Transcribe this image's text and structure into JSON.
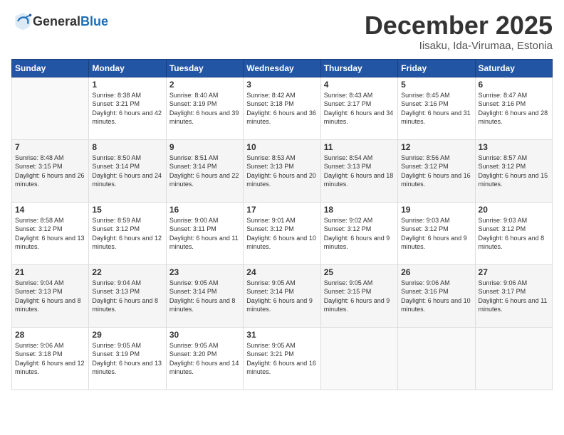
{
  "header": {
    "logo_general": "General",
    "logo_blue": "Blue",
    "month_title": "December 2025",
    "location": "Iisaku, Ida-Virumaa, Estonia"
  },
  "weekdays": [
    "Sunday",
    "Monday",
    "Tuesday",
    "Wednesday",
    "Thursday",
    "Friday",
    "Saturday"
  ],
  "weeks": [
    [
      {
        "num": "",
        "sunrise": "",
        "sunset": "",
        "daylight": "",
        "empty": true
      },
      {
        "num": "1",
        "sunrise": "Sunrise: 8:38 AM",
        "sunset": "Sunset: 3:21 PM",
        "daylight": "Daylight: 6 hours and 42 minutes."
      },
      {
        "num": "2",
        "sunrise": "Sunrise: 8:40 AM",
        "sunset": "Sunset: 3:19 PM",
        "daylight": "Daylight: 6 hours and 39 minutes."
      },
      {
        "num": "3",
        "sunrise": "Sunrise: 8:42 AM",
        "sunset": "Sunset: 3:18 PM",
        "daylight": "Daylight: 6 hours and 36 minutes."
      },
      {
        "num": "4",
        "sunrise": "Sunrise: 8:43 AM",
        "sunset": "Sunset: 3:17 PM",
        "daylight": "Daylight: 6 hours and 34 minutes."
      },
      {
        "num": "5",
        "sunrise": "Sunrise: 8:45 AM",
        "sunset": "Sunset: 3:16 PM",
        "daylight": "Daylight: 6 hours and 31 minutes."
      },
      {
        "num": "6",
        "sunrise": "Sunrise: 8:47 AM",
        "sunset": "Sunset: 3:16 PM",
        "daylight": "Daylight: 6 hours and 28 minutes."
      }
    ],
    [
      {
        "num": "7",
        "sunrise": "Sunrise: 8:48 AM",
        "sunset": "Sunset: 3:15 PM",
        "daylight": "Daylight: 6 hours and 26 minutes."
      },
      {
        "num": "8",
        "sunrise": "Sunrise: 8:50 AM",
        "sunset": "Sunset: 3:14 PM",
        "daylight": "Daylight: 6 hours and 24 minutes."
      },
      {
        "num": "9",
        "sunrise": "Sunrise: 8:51 AM",
        "sunset": "Sunset: 3:14 PM",
        "daylight": "Daylight: 6 hours and 22 minutes."
      },
      {
        "num": "10",
        "sunrise": "Sunrise: 8:53 AM",
        "sunset": "Sunset: 3:13 PM",
        "daylight": "Daylight: 6 hours and 20 minutes."
      },
      {
        "num": "11",
        "sunrise": "Sunrise: 8:54 AM",
        "sunset": "Sunset: 3:13 PM",
        "daylight": "Daylight: 6 hours and 18 minutes."
      },
      {
        "num": "12",
        "sunrise": "Sunrise: 8:56 AM",
        "sunset": "Sunset: 3:12 PM",
        "daylight": "Daylight: 6 hours and 16 minutes."
      },
      {
        "num": "13",
        "sunrise": "Sunrise: 8:57 AM",
        "sunset": "Sunset: 3:12 PM",
        "daylight": "Daylight: 6 hours and 15 minutes."
      }
    ],
    [
      {
        "num": "14",
        "sunrise": "Sunrise: 8:58 AM",
        "sunset": "Sunset: 3:12 PM",
        "daylight": "Daylight: 6 hours and 13 minutes."
      },
      {
        "num": "15",
        "sunrise": "Sunrise: 8:59 AM",
        "sunset": "Sunset: 3:12 PM",
        "daylight": "Daylight: 6 hours and 12 minutes."
      },
      {
        "num": "16",
        "sunrise": "Sunrise: 9:00 AM",
        "sunset": "Sunset: 3:11 PM",
        "daylight": "Daylight: 6 hours and 11 minutes."
      },
      {
        "num": "17",
        "sunrise": "Sunrise: 9:01 AM",
        "sunset": "Sunset: 3:12 PM",
        "daylight": "Daylight: 6 hours and 10 minutes."
      },
      {
        "num": "18",
        "sunrise": "Sunrise: 9:02 AM",
        "sunset": "Sunset: 3:12 PM",
        "daylight": "Daylight: 6 hours and 9 minutes."
      },
      {
        "num": "19",
        "sunrise": "Sunrise: 9:03 AM",
        "sunset": "Sunset: 3:12 PM",
        "daylight": "Daylight: 6 hours and 9 minutes."
      },
      {
        "num": "20",
        "sunrise": "Sunrise: 9:03 AM",
        "sunset": "Sunset: 3:12 PM",
        "daylight": "Daylight: 6 hours and 8 minutes."
      }
    ],
    [
      {
        "num": "21",
        "sunrise": "Sunrise: 9:04 AM",
        "sunset": "Sunset: 3:13 PM",
        "daylight": "Daylight: 6 hours and 8 minutes."
      },
      {
        "num": "22",
        "sunrise": "Sunrise: 9:04 AM",
        "sunset": "Sunset: 3:13 PM",
        "daylight": "Daylight: 6 hours and 8 minutes."
      },
      {
        "num": "23",
        "sunrise": "Sunrise: 9:05 AM",
        "sunset": "Sunset: 3:14 PM",
        "daylight": "Daylight: 6 hours and 8 minutes."
      },
      {
        "num": "24",
        "sunrise": "Sunrise: 9:05 AM",
        "sunset": "Sunset: 3:14 PM",
        "daylight": "Daylight: 6 hours and 9 minutes."
      },
      {
        "num": "25",
        "sunrise": "Sunrise: 9:05 AM",
        "sunset": "Sunset: 3:15 PM",
        "daylight": "Daylight: 6 hours and 9 minutes."
      },
      {
        "num": "26",
        "sunrise": "Sunrise: 9:06 AM",
        "sunset": "Sunset: 3:16 PM",
        "daylight": "Daylight: 6 hours and 10 minutes."
      },
      {
        "num": "27",
        "sunrise": "Sunrise: 9:06 AM",
        "sunset": "Sunset: 3:17 PM",
        "daylight": "Daylight: 6 hours and 11 minutes."
      }
    ],
    [
      {
        "num": "28",
        "sunrise": "Sunrise: 9:06 AM",
        "sunset": "Sunset: 3:18 PM",
        "daylight": "Daylight: 6 hours and 12 minutes."
      },
      {
        "num": "29",
        "sunrise": "Sunrise: 9:05 AM",
        "sunset": "Sunset: 3:19 PM",
        "daylight": "Daylight: 6 hours and 13 minutes."
      },
      {
        "num": "30",
        "sunrise": "Sunrise: 9:05 AM",
        "sunset": "Sunset: 3:20 PM",
        "daylight": "Daylight: 6 hours and 14 minutes."
      },
      {
        "num": "31",
        "sunrise": "Sunrise: 9:05 AM",
        "sunset": "Sunset: 3:21 PM",
        "daylight": "Daylight: 6 hours and 16 minutes."
      },
      {
        "num": "",
        "sunrise": "",
        "sunset": "",
        "daylight": "",
        "empty": true
      },
      {
        "num": "",
        "sunrise": "",
        "sunset": "",
        "daylight": "",
        "empty": true
      },
      {
        "num": "",
        "sunrise": "",
        "sunset": "",
        "daylight": "",
        "empty": true
      }
    ]
  ]
}
